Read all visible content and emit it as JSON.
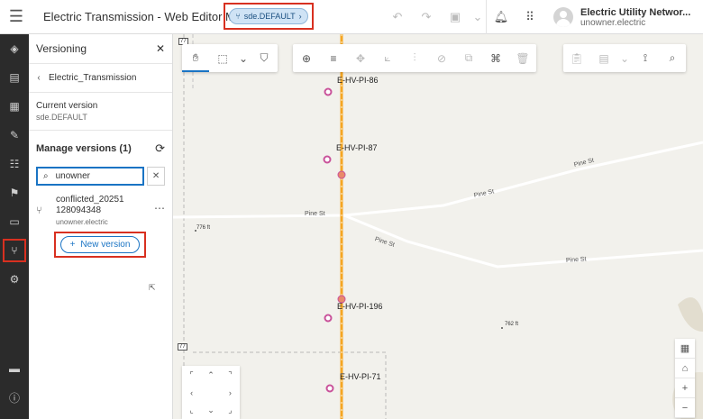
{
  "header": {
    "title": "Electric Transmission - Web Editor Map",
    "version_chip": "sde.DEFAULT",
    "user_title": "Electric Utility Networ...",
    "user_name": "unowner.electric"
  },
  "panel": {
    "title": "Versioning",
    "breadcrumb": "Electric_Transmission",
    "current_version_label": "Current version",
    "current_version_value": "sde.DEFAULT",
    "manage_label": "Manage versions (1)",
    "search_value": "unowner",
    "versions": [
      {
        "name_line1": "conflicted_20251",
        "name_line2": "128094348",
        "owner": "unowner.electric"
      }
    ],
    "new_version_label": "New version"
  },
  "map": {
    "poles": [
      "E-HV-PI-86",
      "E-HV-PI-87",
      "E-HV-PI-196",
      "E-HV-PI-71"
    ],
    "roads": [
      "Pine St",
      "Pine St",
      "Pine St",
      "Pine St",
      "Pine St"
    ],
    "elevations": [
      "776 ft",
      "762 ft"
    ],
    "route_shields": [
      "77",
      "77"
    ]
  },
  "colors": {
    "accent": "#1a74c4",
    "highlight_box": "#d83020",
    "powerline": "#f5a623",
    "pole_marker": "#c9529a",
    "rail_bg": "#2b2b2b"
  }
}
